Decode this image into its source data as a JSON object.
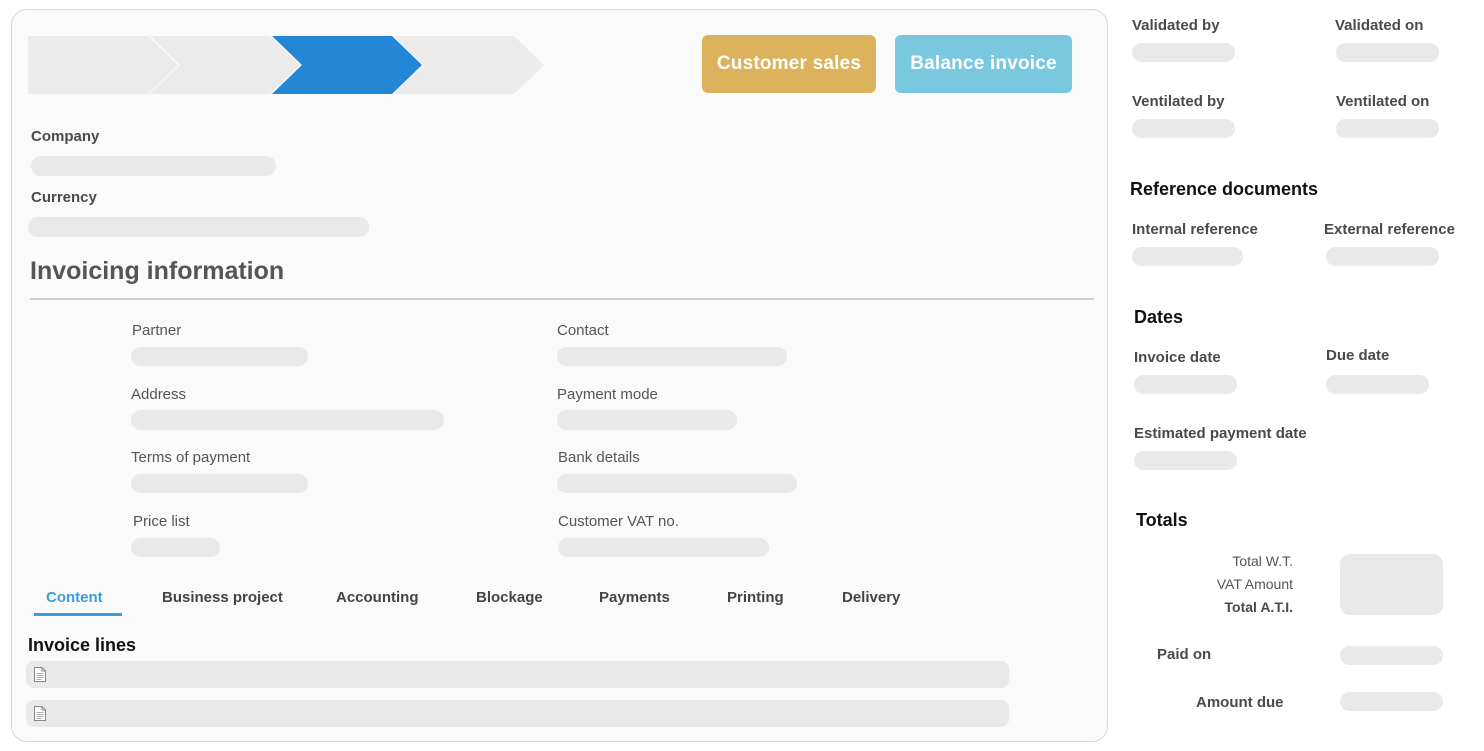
{
  "buttons": {
    "customer_sales": "Customer sales",
    "balance_invoice": "Balance invoice"
  },
  "colors": {
    "step_active": "#2487d6",
    "step_inactive": "#ebebeb",
    "customer_sales": "#dcb35c",
    "balance_invoice": "#7ac8e0",
    "tab_active": "#3a9fd8"
  },
  "form": {
    "company_label": "Company",
    "currency_label": "Currency"
  },
  "invoicing": {
    "title": "Invoicing information",
    "partner": "Partner",
    "contact": "Contact",
    "address": "Address",
    "payment_mode": "Payment mode",
    "terms_of_payment": "Terms of payment",
    "bank_details": "Bank details",
    "price_list": "Price list",
    "customer_vat": "Customer VAT no."
  },
  "tabs": [
    {
      "label": "Content",
      "active": true
    },
    {
      "label": "Business project",
      "active": false
    },
    {
      "label": "Accounting",
      "active": false
    },
    {
      "label": "Blockage",
      "active": false
    },
    {
      "label": "Payments",
      "active": false
    },
    {
      "label": "Printing",
      "active": false
    },
    {
      "label": "Delivery",
      "active": false
    }
  ],
  "invoice_lines": {
    "title": "Invoice lines",
    "row_icon": "document-icon"
  },
  "sidebar": {
    "validated_by": "Validated by",
    "validated_on": "Validated on",
    "ventilated_by": "Ventilated by",
    "ventilated_on": "Ventilated on",
    "reference_documents": "Reference documents",
    "internal_reference": "Internal reference",
    "external_reference": "External reference",
    "dates": "Dates",
    "invoice_date": "Invoice date",
    "due_date": "Due date",
    "estimated_payment_date": "Estimated payment date",
    "totals": "Totals",
    "total_wt": "Total W.T.",
    "vat_amount": "VAT Amount",
    "total_ati": "Total A.T.I.",
    "paid_on": "Paid on",
    "amount_due": "Amount due"
  }
}
